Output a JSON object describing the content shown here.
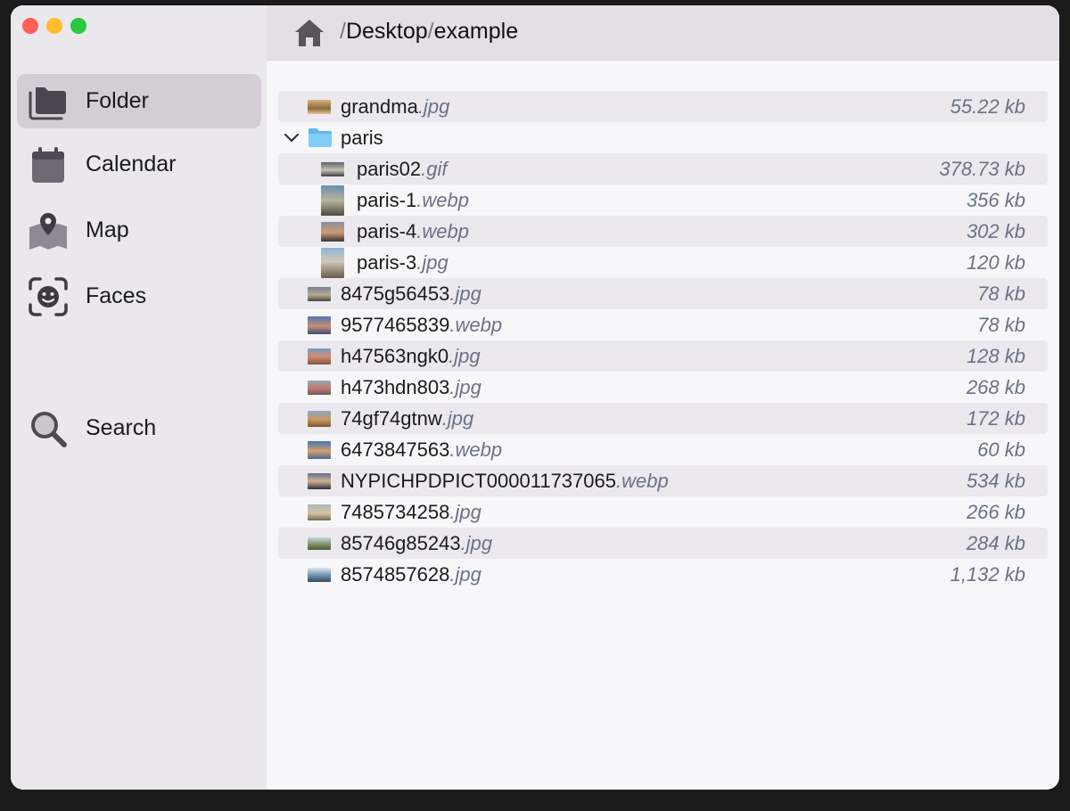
{
  "window": {
    "breadcrumb": [
      "Desktop",
      "example"
    ],
    "separator": "/"
  },
  "sidebar": {
    "items": [
      {
        "label": "Folder",
        "icon": "folder-stack-icon",
        "active": true
      },
      {
        "label": "Calendar",
        "icon": "calendar-icon",
        "active": false
      },
      {
        "label": "Map",
        "icon": "map-pin-icon",
        "active": false
      },
      {
        "label": "Faces",
        "icon": "face-scan-icon",
        "active": false
      },
      {
        "label": "Search",
        "icon": "search-icon",
        "active": false
      }
    ]
  },
  "colors": {
    "sidebar_bg": "#ebe8ed",
    "active_item_bg": "#d3cdd6",
    "topbar_bg": "#e4dfe7",
    "row_shade": "#ebe9ee",
    "secondary_text": "#6b7286",
    "folder_blue": "#6cc4f2"
  },
  "files": [
    {
      "name": "grandma",
      "ext": ".jpg",
      "size": "55.22 kb",
      "level": 0
    },
    {
      "name": "paris",
      "ext": "",
      "size": "",
      "level": 0,
      "folder": true,
      "expanded": true
    },
    {
      "name": "paris02",
      "ext": ".gif",
      "size": "378.73 kb",
      "level": 1
    },
    {
      "name": "paris-1",
      "ext": ".webp",
      "size": "356 kb",
      "level": 1,
      "portrait": true
    },
    {
      "name": "paris-4",
      "ext": ".webp",
      "size": "302 kb",
      "level": 1
    },
    {
      "name": "paris-3",
      "ext": ".jpg",
      "size": "120 kb",
      "level": 1,
      "portrait": true
    },
    {
      "name": "8475g56453",
      "ext": ".jpg",
      "size": "78 kb",
      "level": 0
    },
    {
      "name": "9577465839",
      "ext": ".webp",
      "size": "78 kb",
      "level": 0
    },
    {
      "name": "h47563ngk0",
      "ext": ".jpg",
      "size": "128 kb",
      "level": 0
    },
    {
      "name": "h473hdn803",
      "ext": ".jpg",
      "size": "268 kb",
      "level": 0
    },
    {
      "name": "74gf74gtnw",
      "ext": ".jpg",
      "size": "172 kb",
      "level": 0
    },
    {
      "name": "6473847563",
      "ext": ".webp",
      "size": "60 kb",
      "level": 0
    },
    {
      "name": "NYPICHPDPICT000011737065",
      "ext": ".webp",
      "size": "534 kb",
      "level": 0
    },
    {
      "name": "7485734258",
      "ext": ".jpg",
      "size": "266 kb",
      "level": 0
    },
    {
      "name": "85746g85243",
      "ext": ".jpg",
      "size": "284 kb",
      "level": 0
    },
    {
      "name": "8574857628",
      "ext": ".jpg",
      "size": "1,132 kb",
      "level": 0
    }
  ]
}
